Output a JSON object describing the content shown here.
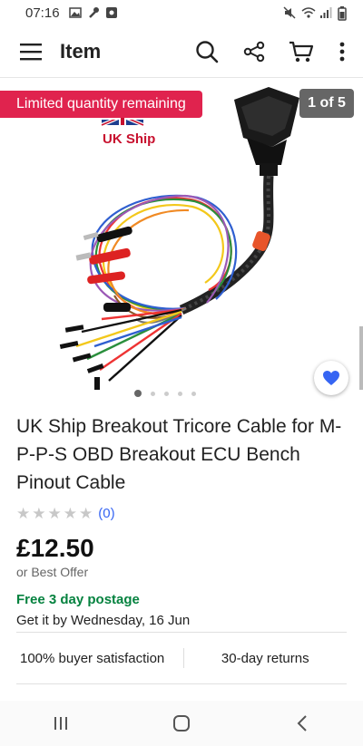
{
  "status": {
    "time": "07:16"
  },
  "appbar": {
    "title": "Item"
  },
  "hero": {
    "badge": "Limited quantity remaining",
    "counter": "1 of 5",
    "ship_label": "UK Ship",
    "dots_total": 5,
    "dots_active": 1
  },
  "product": {
    "title": "UK Ship Breakout Tricore Cable for M-P-P-S OBD Breakout ECU Bench Pinout Cable",
    "rating_stars": 0,
    "rating_count": "(0)",
    "price": "£12.50",
    "offer": "or Best Offer",
    "shipping": "Free 3 day postage",
    "delivery": "Get it by Wednesday, 16 Jun"
  },
  "trust": {
    "satisfaction": "100% buyer satisfaction",
    "returns": "30-day returns"
  },
  "colors": {
    "badge": "#e0234e",
    "link": "#3665f3",
    "shipping": "#05823f",
    "heart": "#3665f3"
  }
}
